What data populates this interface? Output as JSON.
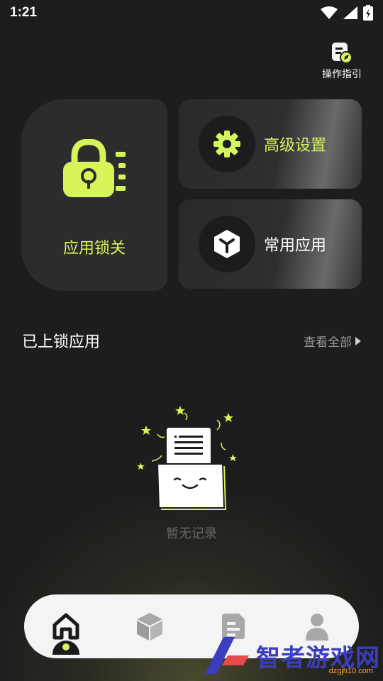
{
  "status_bar": {
    "time": "1:21"
  },
  "guide": {
    "label": "操作指引"
  },
  "cards": {
    "app_lock": {
      "label": "应用锁关"
    },
    "advanced_settings": {
      "label": "高级设置"
    },
    "common_apps": {
      "label": "常用应用"
    }
  },
  "locked_apps": {
    "title": "已上锁应用",
    "view_all": "查看全部",
    "empty_text": "暂无记录"
  },
  "watermark": {
    "text": "智者游戏网",
    "sub": "dzgjh10.com"
  },
  "colors": {
    "accent": "#d6f55a",
    "background": "#1d1d1d",
    "card": "#2c2c2c",
    "tabbar": "#f4f4f4"
  }
}
